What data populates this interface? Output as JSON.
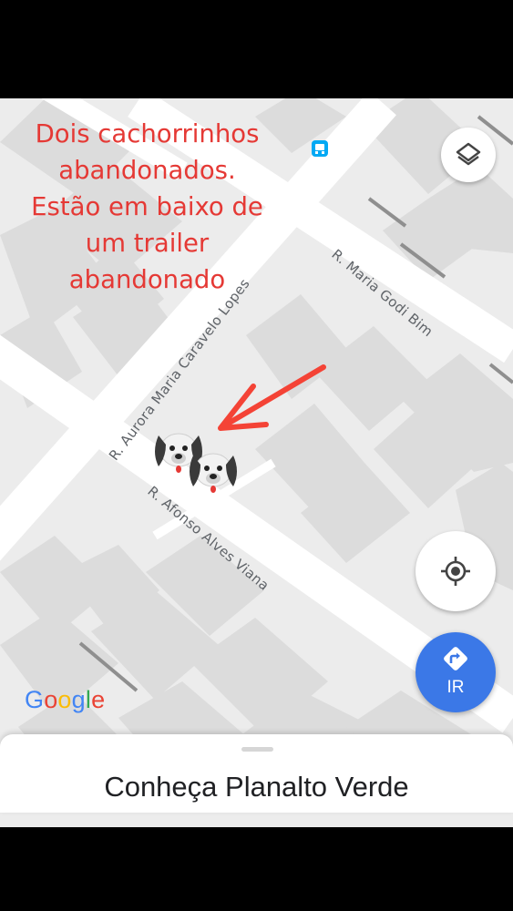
{
  "annotation": {
    "lines": [
      "Dois cachorrinhos",
      "abandonados.",
      "Estão em baixo de",
      "um trailer",
      "abandonado"
    ],
    "color": "#e53935"
  },
  "streets": {
    "maria_godi_bim": "R. Maria Godi Bim",
    "aurora_maria": "R. Aurora Maria Caravelo Lopes",
    "afonso_alves": "R. Afonso Alves Viana"
  },
  "marker": {
    "emoji": "🐶🐶",
    "icon": "dog-face-icon"
  },
  "icons": {
    "layers": "layers-icon",
    "bus_stop": "bus-stop-icon",
    "my_location": "my-location-icon",
    "directions": "directions-icon",
    "arrow": "red-arrow-icon"
  },
  "go_button": {
    "label": "IR",
    "color": "#3b78e7"
  },
  "logo": {
    "letters": [
      {
        "ch": "G",
        "color": "#4285F4"
      },
      {
        "ch": "o",
        "color": "#EA4335"
      },
      {
        "ch": "o",
        "color": "#FBBC05"
      },
      {
        "ch": "g",
        "color": "#4285F4"
      },
      {
        "ch": "l",
        "color": "#34A853"
      },
      {
        "ch": "e",
        "color": "#EA4335"
      }
    ]
  },
  "sheet": {
    "title": "Conheça Planalto Verde"
  },
  "colors": {
    "map_background": "#ececec",
    "road": "#ffffff",
    "building": "#dcdcdc",
    "building_dark": "#8f8f8f"
  }
}
